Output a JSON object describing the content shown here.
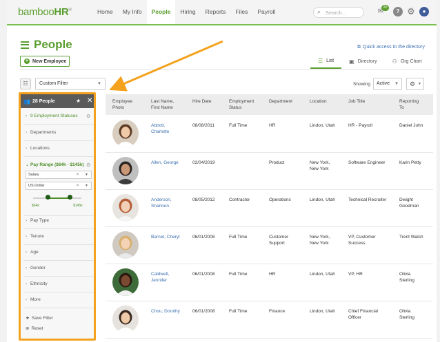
{
  "brand": {
    "name_light": "bamboo",
    "name_bold": "HR",
    "mark": "®"
  },
  "nav": [
    "Home",
    "My Info",
    "People",
    "Hiring",
    "Reports",
    "Files",
    "Payroll"
  ],
  "nav_active_index": 2,
  "search": {
    "placeholder": "Search..."
  },
  "inbox_count": "20",
  "help_glyph": "?",
  "page": {
    "title": "People",
    "quick_access": "Quick access to the directory",
    "new_employee": "New Employee"
  },
  "view_tabs": [
    {
      "label": "List",
      "icon": "list-icon",
      "active": true
    },
    {
      "label": "Directory",
      "icon": "directory-icon",
      "active": false
    },
    {
      "label": "Org Chart",
      "icon": "org-chart-icon",
      "active": false
    }
  ],
  "filter": {
    "selected": "Custom Filter"
  },
  "showing": {
    "label": "Showing",
    "value": "Active"
  },
  "sidebar": {
    "count_label": "28 People",
    "employment": "9 Employment Statuses",
    "departments": "Departments",
    "locations": "Locations",
    "pay_range": "Pay Range ($64k - $145k)",
    "pay_type_select": "Salary",
    "currency_select": "US Dollar",
    "min_label": "$64k",
    "max_label": "$145k",
    "slider": {
      "min_fraction": 0.3,
      "max_fraction": 0.77
    },
    "pay_type": "Pay Type",
    "tenure": "Tenure",
    "age": "Age",
    "gender": "Gender",
    "ethnicity": "Ethnicity",
    "more": "More",
    "save_filter": "Save Filter",
    "reset": "Reset"
  },
  "table": {
    "headers": {
      "photo": [
        "Employee",
        "Photo"
      ],
      "name": [
        "Last Name,",
        "First Name"
      ],
      "hire": [
        "Hire Date",
        ""
      ],
      "status": [
        "Employment",
        "Status"
      ],
      "dept": [
        "Department",
        ""
      ],
      "loc": [
        "Location",
        ""
      ],
      "title": [
        "Job Title",
        ""
      ],
      "reports": [
        "Reporting",
        "To"
      ]
    },
    "rows": [
      {
        "name": [
          "Abbott,",
          "Charlotte"
        ],
        "hire": "08/08/2011",
        "status": [
          "Full Time",
          ""
        ],
        "dept": [
          "HR",
          ""
        ],
        "loc": [
          "Lindon, Utah",
          ""
        ],
        "title": [
          "HR - Payroll",
          ""
        ],
        "reports": [
          "Daniel John",
          ""
        ]
      },
      {
        "name": [
          "Allen, George",
          ""
        ],
        "hire": "02/04/2019",
        "status": [
          "",
          ""
        ],
        "dept": [
          "Product",
          ""
        ],
        "loc": [
          "New York,",
          "New York"
        ],
        "title": [
          "Software Engineer",
          ""
        ],
        "reports": [
          "Karin Petty",
          ""
        ]
      },
      {
        "name": [
          "Anderson,",
          "Shannon"
        ],
        "hire": "08/05/2012",
        "status": [
          "Contractor",
          ""
        ],
        "dept": [
          "Operations",
          ""
        ],
        "loc": [
          "Lindon, Utah",
          ""
        ],
        "title": [
          "Technical Recruiter",
          ""
        ],
        "reports": [
          "Dwight",
          "Goodman"
        ]
      },
      {
        "name": [
          "Barnet, Cheryl",
          ""
        ],
        "hire": "06/01/2008",
        "status": [
          "Full Time",
          ""
        ],
        "dept": [
          "Customer",
          "Support"
        ],
        "loc": [
          "New York,",
          "New York"
        ],
        "title": [
          "VP, Customer",
          "Success"
        ],
        "reports": [
          "Trent Walsh",
          ""
        ]
      },
      {
        "name": [
          "Caldwell,",
          "Jennifer"
        ],
        "hire": "06/01/2008",
        "status": [
          "Full Time",
          ""
        ],
        "dept": [
          "HR",
          ""
        ],
        "loc": [
          "Lindon, Utah",
          ""
        ],
        "title": [
          "VP, HR",
          ""
        ],
        "reports": [
          "Olivia",
          "Sterling"
        ]
      },
      {
        "name": [
          "Chou, Dorothy",
          ""
        ],
        "hire": "06/01/2008",
        "status": [
          "Full Time",
          ""
        ],
        "dept": [
          "Finance",
          ""
        ],
        "loc": [
          "Lindon, Utah",
          ""
        ],
        "title": [
          "Chief Financial",
          "Officer"
        ],
        "reports": [
          "Olivia",
          "Sterling"
        ]
      }
    ],
    "avatars": [
      {
        "bg": "#d9cdbf",
        "hair": "#5b3b25",
        "skin": "#f0c9a8",
        "shirt": "#ffffff"
      },
      {
        "bg": "#bfbfbf",
        "hair": "#2b2320",
        "skin": "#c99775",
        "shirt": "#3b3b3b"
      },
      {
        "bg": "#e7e3df",
        "hair": "#b55d36",
        "skin": "#f2d0b8",
        "shirt": "#f5f5f5"
      },
      {
        "bg": "#cfc9c2",
        "hair": "#d8b06e",
        "skin": "#f3d2b5",
        "shirt": "#e9e9e9"
      },
      {
        "bg": "#3d6c3a",
        "hair": "#2a1a12",
        "skin": "#7b4a30",
        "shirt": "#f2f2f2"
      },
      {
        "bg": "#e6e2dd",
        "hair": "#3b2a22",
        "skin": "#eecaa9",
        "shirt": "#ffffff"
      }
    ]
  },
  "colors": {
    "brand_green": "#5a9e2f",
    "link_blue": "#3a6fb0",
    "annotation_orange": "#f4a21d"
  }
}
